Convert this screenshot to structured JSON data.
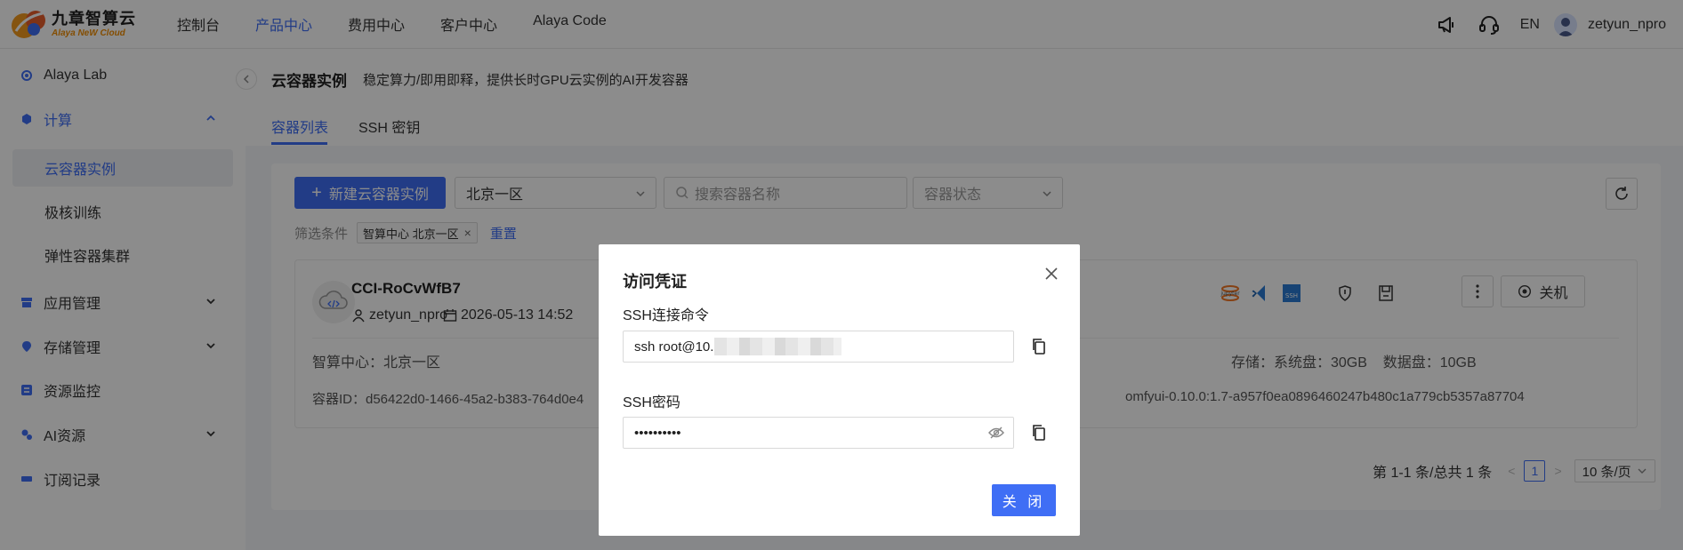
{
  "brand": {
    "name_cn": "九章智算云",
    "name_en": "Alaya NeW Cloud"
  },
  "topnav": [
    {
      "label": "控制台",
      "active": false
    },
    {
      "label": "产品中心",
      "active": true
    },
    {
      "label": "费用中心",
      "active": false
    },
    {
      "label": "客户中心",
      "active": false
    },
    {
      "label": "Alaya Code",
      "active": false
    }
  ],
  "topright": {
    "lang": "EN",
    "username": "zetyun_npro"
  },
  "sidebar": {
    "alaya_lab": "Alaya Lab",
    "compute": "计算",
    "sub": [
      "云容器实例",
      "极核训练",
      "弹性容器集群"
    ],
    "app_mgmt": "应用管理",
    "storage_mgmt": "存储管理",
    "resource_monitor": "资源监控",
    "ai_resources": "AI资源",
    "subscriptions": "订阅记录"
  },
  "page": {
    "title": "云容器实例",
    "subtitle": "稳定算力/即用即释，提供长时GPU云实例的AI开发容器",
    "tabs": [
      "容器列表",
      "SSH 密钥"
    ]
  },
  "toolbar": {
    "new_button": "新建云容器实例",
    "region_select": "北京一区",
    "search_placeholder": "搜索容器名称",
    "status_placeholder": "容器状态",
    "filter_label": "筛选条件",
    "filter_chip": "智算中心 北京一区",
    "reset": "重置"
  },
  "instance": {
    "name": "CCI-RoCvWfB7",
    "user": "zetyun_npro",
    "created": "2026-05-13 14:52",
    "region": "智算中心：北京一区",
    "storage": "存储：系统盘：30GB    数据盘：10GB",
    "container_id": "容器ID：d56422d0-1466-45a2-b383-764d0e4",
    "image": "omfyui-0.10.0:1.7-a957f0ea0896460247b480c1a779cb5357a87704",
    "power_button": "关机",
    "ssh_badge": "SSH",
    "jupyter_badge": "jupyter"
  },
  "pagination": {
    "summary": "第 1-1 条/总共 1 条",
    "current": "1",
    "page_size": "10 条/页"
  },
  "modal": {
    "title": "访问凭证",
    "ssh_cmd_label": "SSH连接命令",
    "ssh_cmd_value": "ssh root@10.",
    "ssh_pwd_label": "SSH密码",
    "ssh_pwd_value": "••••••••••",
    "close_button": "关 闭"
  }
}
